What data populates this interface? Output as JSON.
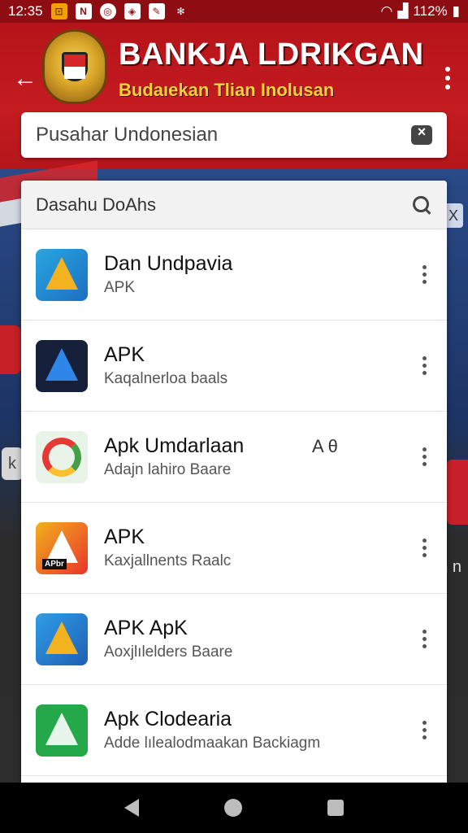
{
  "status_bar": {
    "time": "12:35",
    "battery": "112%"
  },
  "header": {
    "title": "BANKJA LDRIKGAN",
    "subtitle": "Budaıekan Tlian Inolusan",
    "search": {
      "value": "Pusahar Undonesian"
    }
  },
  "results": {
    "header_title": "Dasahu DoAhs",
    "items": [
      {
        "name": "Dan Undpavia",
        "subtitle": "APK",
        "extra": "",
        "icon": "apk-blue-a-icon"
      },
      {
        "name": "APK",
        "subtitle": "Kaqalnerloa baals",
        "extra": "",
        "icon": "apk-dark-a-icon"
      },
      {
        "name": "Apk Umdarlaan",
        "subtitle": "Adajn lahiro Baare",
        "extra": "A θ",
        "icon": "apk-ring-icon"
      },
      {
        "name": "APK",
        "subtitle": "Kaxjallnents Raalc",
        "extra": "",
        "icon": "apk-orange-a-icon",
        "icon_label": "APbr"
      },
      {
        "name": "APK ApK",
        "subtitle": "Aoxjlılelders Baare",
        "extra": "",
        "icon": "apk-blue-a2-icon"
      },
      {
        "name": "Apk Clodearia",
        "subtitle": "Adde lılealodmaakan Backiagm",
        "extra": "",
        "icon": "apk-green-a-icon"
      },
      {
        "name": "",
        "subtitle": "",
        "extra": "",
        "icon": "apk-dark-partial-icon"
      }
    ]
  },
  "background": {
    "left_tab": "k",
    "right_tab": "X",
    "right_text": "n\n n"
  },
  "colors": {
    "header_red": "#c41b20",
    "subtitle_yellow": "#f7d33b"
  }
}
